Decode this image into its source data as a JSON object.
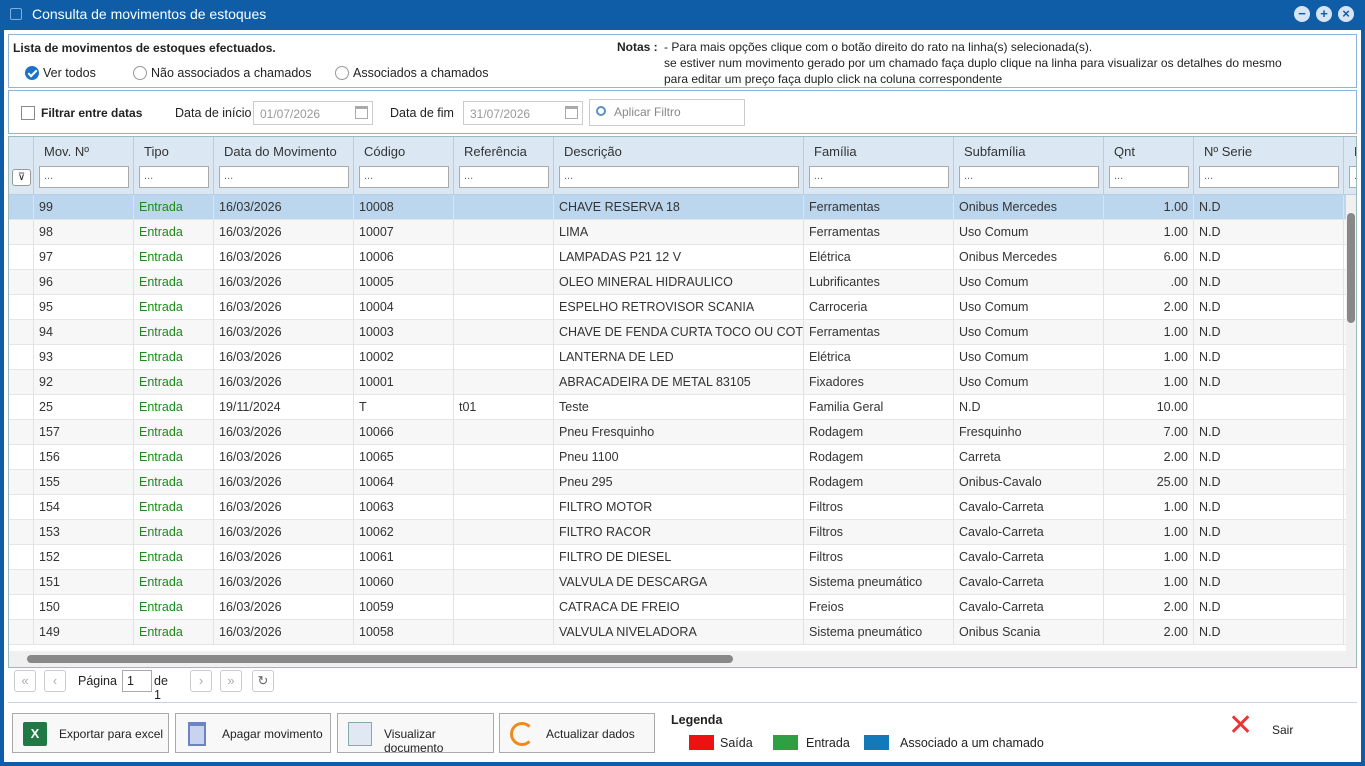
{
  "window": {
    "title": "Consulta de movimentos de estoques"
  },
  "top": {
    "list_title": "Lista de movimentos de estoques efectuados.",
    "radios": [
      {
        "label": "Ver todos",
        "selected": true
      },
      {
        "label": "Não associados a chamados",
        "selected": false
      },
      {
        "label": "Associados a chamados",
        "selected": false
      }
    ],
    "notes_label": "Notas :",
    "notes": [
      "- Para mais opções clique com o botão direito do rato na linha(s) selecionada(s).",
      "se estiver num movimento gerado por um chamado faça duplo clique na linha para visualizar os detalhes do mesmo",
      "para editar um preço faça duplo click na coluna correspondente"
    ]
  },
  "filter": {
    "checkbox_label": "Filtrar entre datas",
    "start_label": "Data de início",
    "start_value": "01/07/2026",
    "end_label": "Data de fim",
    "end_value": "31/07/2026",
    "apply_placeholder": "Aplicar Filtro"
  },
  "grid": {
    "columns": [
      "Mov. Nº",
      "Tipo",
      "Data do Movimento",
      "Código",
      "Referência",
      "Descrição",
      "Família",
      "Subfamília",
      "Qnt",
      "Nº Serie",
      "P"
    ],
    "filter_placeholder": "...",
    "rows": [
      [
        "99",
        "Entrada",
        "16/03/2026",
        "10008",
        "",
        "CHAVE RESERVA 18",
        "Ferramentas",
        "Onibus Mercedes",
        "1.00",
        "N.D"
      ],
      [
        "98",
        "Entrada",
        "16/03/2026",
        "10007",
        "",
        "LIMA",
        "Ferramentas",
        "Uso Comum",
        "1.00",
        "N.D"
      ],
      [
        "97",
        "Entrada",
        "16/03/2026",
        "10006",
        "",
        "LAMPADAS P21 12 V",
        "Elétrica",
        "Onibus Mercedes",
        "6.00",
        "N.D"
      ],
      [
        "96",
        "Entrada",
        "16/03/2026",
        "10005",
        "",
        "OLEO MINERAL HIDRAULICO",
        "Lubrificantes",
        "Uso Comum",
        ".00",
        "N.D"
      ],
      [
        "95",
        "Entrada",
        "16/03/2026",
        "10004",
        "",
        "ESPELHO RETROVISOR SCANIA",
        "Carroceria",
        "Uso Comum",
        "2.00",
        "N.D"
      ],
      [
        "94",
        "Entrada",
        "16/03/2026",
        "10003",
        "",
        "CHAVE DE FENDA CURTA TOCO OU COTOCO",
        "Ferramentas",
        "Uso Comum",
        "1.00",
        "N.D"
      ],
      [
        "93",
        "Entrada",
        "16/03/2026",
        "10002",
        "",
        "LANTERNA DE LED",
        "Elétrica",
        "Uso Comum",
        "1.00",
        "N.D"
      ],
      [
        "92",
        "Entrada",
        "16/03/2026",
        "10001",
        "",
        "ABRACADEIRA DE METAL 83105",
        "Fixadores",
        "Uso Comum",
        "1.00",
        "N.D"
      ],
      [
        "25",
        "Entrada",
        "19/11/2024",
        "T",
        "t01",
        "Teste",
        "Familia Geral",
        "N.D",
        "10.00",
        ""
      ],
      [
        "157",
        "Entrada",
        "16/03/2026",
        "10066",
        "",
        "Pneu Fresquinho",
        "Rodagem",
        "Fresquinho",
        "7.00",
        "N.D"
      ],
      [
        "156",
        "Entrada",
        "16/03/2026",
        "10065",
        "",
        "Pneu 1100",
        "Rodagem",
        "Carreta",
        "2.00",
        "N.D"
      ],
      [
        "155",
        "Entrada",
        "16/03/2026",
        "10064",
        "",
        "Pneu 295",
        "Rodagem",
        "Onibus-Cavalo",
        "25.00",
        "N.D"
      ],
      [
        "154",
        "Entrada",
        "16/03/2026",
        "10063",
        "",
        "FILTRO MOTOR",
        "Filtros",
        "Cavalo-Carreta",
        "1.00",
        "N.D"
      ],
      [
        "153",
        "Entrada",
        "16/03/2026",
        "10062",
        "",
        "FILTRO RACOR",
        "Filtros",
        "Cavalo-Carreta",
        "1.00",
        "N.D"
      ],
      [
        "152",
        "Entrada",
        "16/03/2026",
        "10061",
        "",
        "FILTRO DE DIESEL",
        "Filtros",
        "Cavalo-Carreta",
        "1.00",
        "N.D"
      ],
      [
        "151",
        "Entrada",
        "16/03/2026",
        "10060",
        "",
        "VALVULA DE DESCARGA",
        "Sistema pneumático",
        "Cavalo-Carreta",
        "1.00",
        "N.D"
      ],
      [
        "150",
        "Entrada",
        "16/03/2026",
        "10059",
        "",
        "CATRACA DE FREIO",
        "Freios",
        "Cavalo-Carreta",
        "2.00",
        "N.D"
      ],
      [
        "149",
        "Entrada",
        "16/03/2026",
        "10058",
        "",
        "VALVULA NIVELADORA",
        "Sistema pneumático",
        "Onibus Scania",
        "2.00",
        "N.D"
      ]
    ]
  },
  "pager": {
    "page_label": "Página",
    "page_value": "1",
    "of_label": "de 1"
  },
  "actions": {
    "export": "Exportar para excel",
    "delete": "Apagar movimento",
    "view": "Visualizar documento",
    "refresh": "Actualizar dados",
    "exit": "Sair"
  },
  "legend": {
    "title": "Legenda",
    "items": [
      {
        "label": "Saída",
        "color": "#ee1111"
      },
      {
        "label": "Entrada",
        "color": "#2ea043"
      },
      {
        "label": "Associado a um chamado",
        "color": "#1479b8"
      }
    ]
  }
}
